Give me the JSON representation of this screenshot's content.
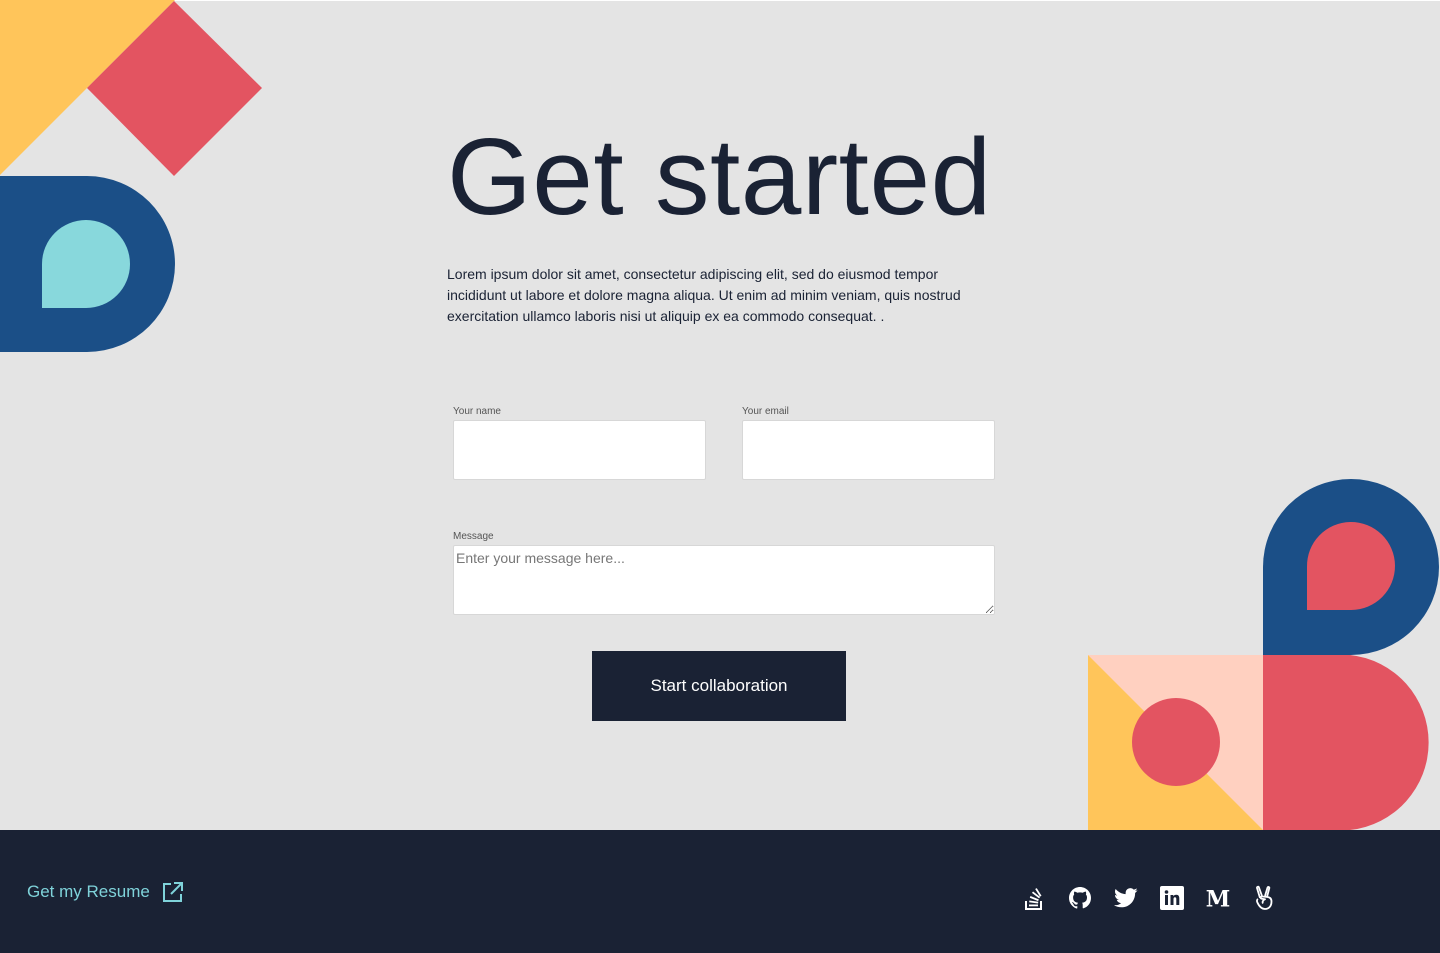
{
  "page": {
    "title": "Get started",
    "intro": "Lorem ipsum dolor sit amet, consectetur adipiscing elit, sed do eiusmod tempor incididunt ut labore et dolore magna aliqua. Ut enim ad minim veniam, quis nostrud exercitation ullamco laboris nisi ut aliquip ex ea commodo consequat. ."
  },
  "form": {
    "name_label": "Your name",
    "name_value": "",
    "email_label": "Your email",
    "email_value": "",
    "message_label": "Message",
    "message_placeholder": "Enter your message here...",
    "submit_label": "Start collaboration"
  },
  "footer": {
    "resume_label": "Get my Resume",
    "resume_icon": "external-link-icon",
    "socials": [
      {
        "icon": "stackoverflow-icon"
      },
      {
        "icon": "github-icon"
      },
      {
        "icon": "twitter-icon"
      },
      {
        "icon": "linkedin-icon"
      },
      {
        "icon": "medium-icon"
      },
      {
        "icon": "angellist-icon"
      }
    ]
  },
  "colors": {
    "background": "#e4e4e4",
    "navy": "#1a2234",
    "accent_cyan": "#7fd3da",
    "deco_yellow": "#ffc55a",
    "deco_red": "#e35461",
    "deco_blue": "#1b4f87",
    "deco_peach": "#ffd0c0",
    "deco_teal": "#88d8dc"
  }
}
